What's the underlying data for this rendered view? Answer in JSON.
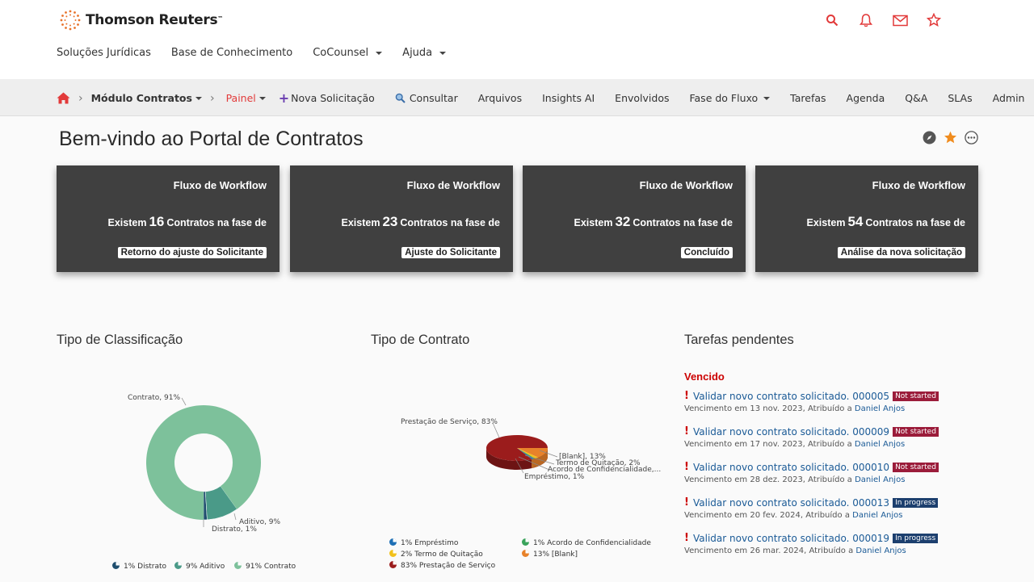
{
  "brand": {
    "name": "Thomson Reuters",
    "tm": "™"
  },
  "top_nav": [
    {
      "label": "Soluções Jurídicas",
      "dropdown": false
    },
    {
      "label": "Base de Conhecimento",
      "dropdown": false
    },
    {
      "label": "CoCounsel",
      "dropdown": true
    },
    {
      "label": "Ajuda",
      "dropdown": true
    }
  ],
  "top_icons": [
    "search-icon",
    "bell-icon",
    "mail-icon",
    "star-icon"
  ],
  "subnav": {
    "module": "Módulo Contratos",
    "painel": "Painel",
    "nova": "Nova Solicitação",
    "consultar": "Consultar",
    "items": [
      "Arquivos",
      "Insights AI",
      "Envolvidos",
      "Fase do Fluxo",
      "Tarefas",
      "Agenda",
      "Q&A",
      "SLAs",
      "Admin"
    ]
  },
  "page_title": "Bem-vindo ao Portal de Contratos",
  "cards": [
    {
      "title": "Fluxo de Workflow",
      "prefix": "Existem",
      "count": "16",
      "suffix": "Contratos na fase de",
      "phase": "Retorno do ajuste do Solicitante"
    },
    {
      "title": "Fluxo de Workflow",
      "prefix": "Existem",
      "count": "23",
      "suffix": "Contratos na fase de",
      "phase": "Ajuste do Solicitante"
    },
    {
      "title": "Fluxo de Workflow",
      "prefix": "Existem",
      "count": "32",
      "suffix": "Contratos na fase de",
      "phase": "Concluído"
    },
    {
      "title": "Fluxo de Workflow",
      "prefix": "Existem",
      "count": "54",
      "suffix": "Contratos na fase de",
      "phase": "Análise da nova solicitação"
    }
  ],
  "section_titles": {
    "classificacao": "Tipo de Classificação",
    "contrato": "Tipo de Contrato",
    "tarefas": "Tarefas pendentes"
  },
  "chart_data": [
    {
      "type": "pie",
      "title": "Tipo de Classificação",
      "categories": [
        "Contrato",
        "Aditivo",
        "Distrato"
      ],
      "values": [
        91,
        9,
        1
      ],
      "colors": [
        "#7dc19b",
        "#4a9a88",
        "#1f4e6e"
      ],
      "labels": [
        "Contrato, 91%",
        "Aditivo, 9%",
        "Distrato, 1%"
      ],
      "legend": [
        "1% Distrato",
        "9% Aditivo",
        "91% Contrato"
      ]
    },
    {
      "type": "pie",
      "title": "Tipo de Contrato",
      "categories": [
        "Prestação de Serviço",
        "[Blank]",
        "Termo de Quitação",
        "Acordo de Confidencialidade",
        "Empréstimo"
      ],
      "values": [
        83,
        13,
        2,
        1,
        1
      ],
      "colors": [
        "#9b1c1c",
        "#e8822a",
        "#f2c11b",
        "#3aa35b",
        "#1d6fb5"
      ],
      "labels": [
        "Prestação de Serviço, 83%",
        "[Blank], 13%",
        "Termo de Quitação, 2%",
        "Acordo de Confidencialidade,...",
        "Empréstimo, 1%"
      ],
      "legend": [
        "1% Empréstimo",
        "1% Acordo de Confidencialidade",
        "2% Termo de Quitação",
        "13% [Blank]",
        "83% Prestação de Serviço"
      ]
    }
  ],
  "tasks": {
    "group": "Vencido",
    "items": [
      {
        "title": "Validar novo contrato solicitado. 000005",
        "status": "Not started",
        "status_color": "#9b1c3a",
        "due": "Vencimento em 13 nov. 2023, Atribuído a",
        "user": "Daniel Anjos"
      },
      {
        "title": "Validar novo contrato solicitado. 000009",
        "status": "Not started",
        "status_color": "#9b1c3a",
        "due": "Vencimento em 17 nov. 2023, Atribuído a",
        "user": "Daniel Anjos"
      },
      {
        "title": "Validar novo contrato solicitado. 000010",
        "status": "Not started",
        "status_color": "#9b1c3a",
        "due": "Vencimento em 28 dez. 2023, Atribuído a",
        "user": "Daniel Anjos"
      },
      {
        "title": "Validar novo contrato solicitado. 000013",
        "status": "In progress",
        "status_color": "#1c3f6e",
        "due": "Vencimento em 20 fev. 2024, Atribuído a",
        "user": "Daniel Anjos"
      },
      {
        "title": "Validar novo contrato solicitado. 000019",
        "status": "In progress",
        "status_color": "#1c3f6e",
        "due": "Vencimento em 26 mar. 2024, Atribuído a",
        "user": "Daniel Anjos"
      }
    ]
  },
  "colors": {
    "accent": "#e23a3a",
    "card_bg": "#404040",
    "link": "#1a5a96"
  }
}
